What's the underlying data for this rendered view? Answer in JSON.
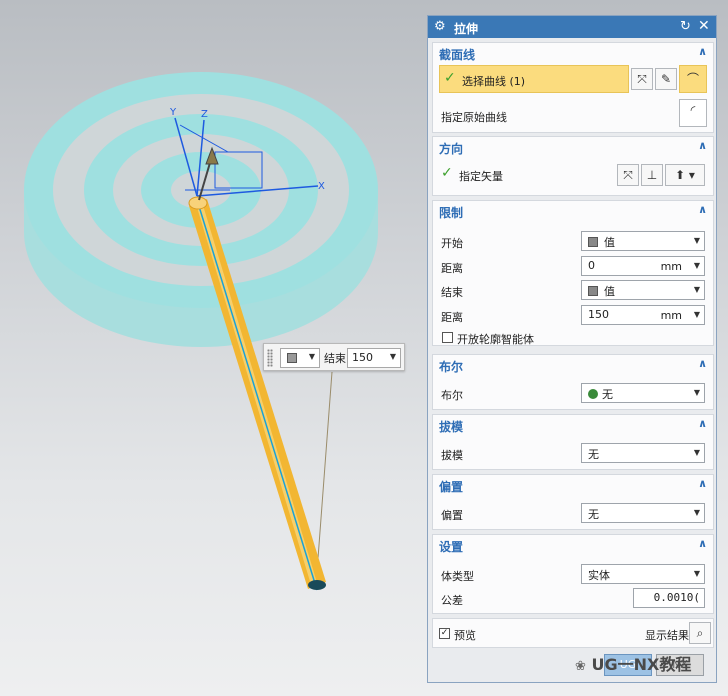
{
  "viewport": {
    "axes": {
      "x": "X",
      "y": "Y",
      "z": "Z"
    },
    "colors": {
      "disc_cyan": "#9fe0e0",
      "disc_gray": "#cfd6d8",
      "rod": "#f2b632",
      "axis_blue": "#1e5ae0"
    }
  },
  "float_widget": {
    "label": "结束",
    "value": "150"
  },
  "dialog": {
    "title": "拉伸",
    "sections": {
      "section_curve": {
        "title": "截面线",
        "select_curve": "选择曲线 (1)",
        "specify_origin": "指定原始曲线"
      },
      "direction": {
        "title": "方向",
        "specify_vector": "指定矢量"
      },
      "limits": {
        "title": "限制",
        "start_label": "开始",
        "start_value": "值",
        "start_dist_label": "距离",
        "start_dist_value": "0",
        "start_unit": "mm",
        "end_label": "结束",
        "end_value": "值",
        "end_dist_label": "距离",
        "end_dist_value": "150",
        "end_unit": "mm",
        "open_profile": "开放轮廓智能体"
      },
      "boolean": {
        "title": "布尔",
        "label": "布尔",
        "value": "无"
      },
      "draft": {
        "title": "拔模",
        "label": "拔模",
        "value": "无"
      },
      "offset": {
        "title": "偏置",
        "label": "偏置",
        "value": "无"
      },
      "settings": {
        "title": "设置",
        "body_type_label": "体类型",
        "body_type_value": "实体",
        "tolerance_label": "公差",
        "tolerance_value": "0.0010("
      }
    },
    "footer": {
      "preview": "预览",
      "show_result": "显示结果"
    },
    "buttons": {
      "ok": "UG",
      "apply": "NX"
    }
  },
  "watermark": "UG一NX教程"
}
